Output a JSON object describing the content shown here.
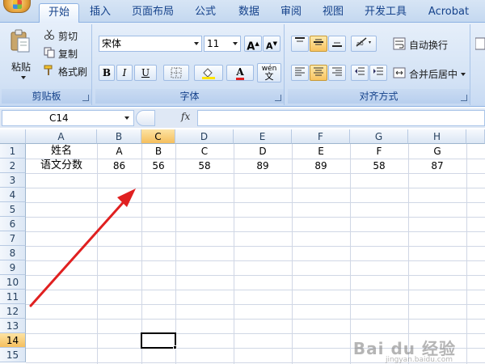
{
  "tabs": [
    "开始",
    "插入",
    "页面布局",
    "公式",
    "数据",
    "审阅",
    "视图",
    "开发工具",
    "Acrobat"
  ],
  "clipboard": {
    "paste": "粘贴",
    "cut": "剪切",
    "copy": "复制",
    "format_painter": "格式刷",
    "label": "剪贴板"
  },
  "font": {
    "name": "宋体",
    "size": "11",
    "label": "字体",
    "grow": "A",
    "shrink": "A",
    "bold": "B",
    "italic": "I",
    "underline": "U",
    "font_color_glyph": "A",
    "phonetic_top": "wén",
    "phonetic_bottom": "文"
  },
  "alignment": {
    "wrap_text": "自动换行",
    "merge_center": "合并后居中",
    "label": "对齐方式"
  },
  "formula_bar": {
    "name_box": "C14",
    "fx": "fx",
    "content": ""
  },
  "grid": {
    "columns": [
      "A",
      "B",
      "C",
      "D",
      "E",
      "F",
      "G",
      "H"
    ],
    "selected_column": "C",
    "rows": [
      "1",
      "2",
      "3",
      "4",
      "5",
      "6",
      "7",
      "8",
      "9",
      "10",
      "11",
      "12",
      "13",
      "14",
      "15"
    ],
    "selected_row": "14",
    "cells": {
      "row1": [
        "姓名",
        "A",
        "B",
        "C",
        "D",
        "E",
        "F",
        "G"
      ],
      "row2": [
        "语文分数",
        "86",
        "56",
        "58",
        "89",
        "89",
        "58",
        "87"
      ]
    }
  },
  "annotation": {
    "arrow_color": "#e02020"
  },
  "watermark": {
    "text": "Bai du 经验",
    "sub": "jingyan.baidu.com"
  },
  "colors": {
    "accent": "#15428b",
    "selection": "#f5bf5e",
    "font_color": "#e02020",
    "fill_color": "#ffe400"
  }
}
